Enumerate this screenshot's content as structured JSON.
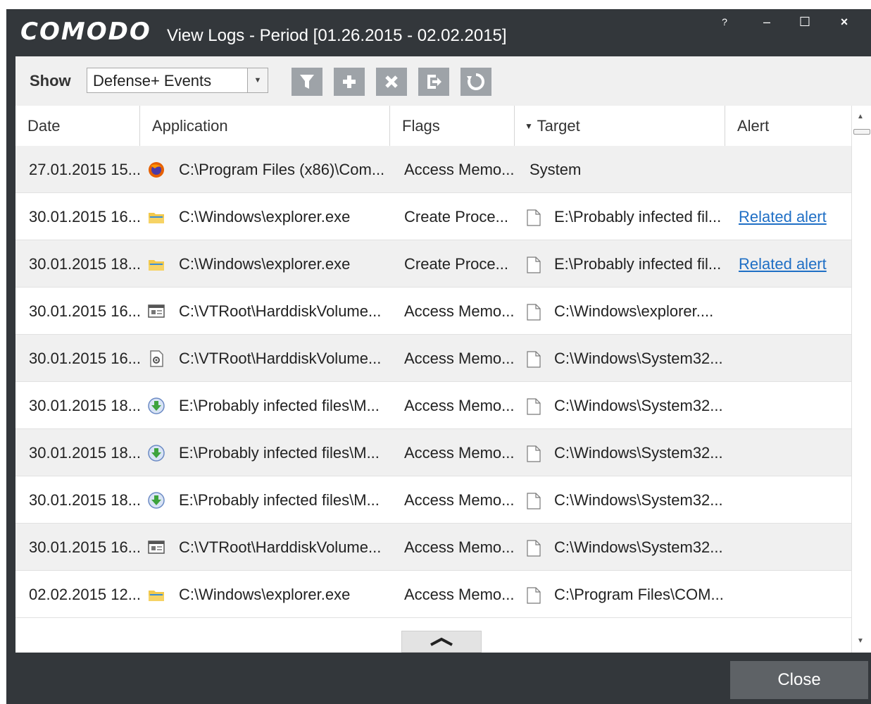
{
  "window": {
    "brand": "COMODO",
    "title": "View Logs - Period [01.26.2015 - 02.02.2015]",
    "help_label": "?",
    "minimize_label": "–",
    "maximize_label": "☐",
    "close_label": "×"
  },
  "toolbar": {
    "show_label": "Show",
    "filter_value": "Defense+ Events",
    "buttons": [
      "filter-icon",
      "add-icon",
      "delete-icon",
      "export-icon",
      "refresh-icon"
    ]
  },
  "table": {
    "columns": {
      "date": "Date",
      "application": "Application",
      "flags": "Flags",
      "target": "Target",
      "alert": "Alert"
    },
    "sorted_column": "Target",
    "rows": [
      {
        "date": "27.01.2015 15...",
        "app_icon": "firefox-icon",
        "application": "C:\\Program Files (x86)\\Com...",
        "flags": "Access Memo...",
        "target_icon": "",
        "target": "System",
        "alert": ""
      },
      {
        "date": "30.01.2015 16...",
        "app_icon": "folder-icon",
        "application": "C:\\Windows\\explorer.exe",
        "flags": "Create Proce...",
        "target_icon": "file-icon",
        "target": "E:\\Probably infected fil...",
        "alert": "Related alert"
      },
      {
        "date": "30.01.2015 18...",
        "app_icon": "folder-icon",
        "application": "C:\\Windows\\explorer.exe",
        "flags": "Create Proce...",
        "target_icon": "file-icon",
        "target": "E:\\Probably infected fil...",
        "alert": "Related alert"
      },
      {
        "date": "30.01.2015 16...",
        "app_icon": "window-app-icon",
        "application": "C:\\VTRoot\\HarddiskVolume...",
        "flags": "Access Memo...",
        "target_icon": "file-icon",
        "target": "C:\\Windows\\explorer....",
        "alert": ""
      },
      {
        "date": "30.01.2015 16...",
        "app_icon": "settings-file-icon",
        "application": "C:\\VTRoot\\HarddiskVolume...",
        "flags": "Access Memo...",
        "target_icon": "file-icon",
        "target": "C:\\Windows\\System32...",
        "alert": ""
      },
      {
        "date": "30.01.2015 18...",
        "app_icon": "download-icon",
        "application": "E:\\Probably infected files\\M...",
        "flags": "Access Memo...",
        "target_icon": "file-icon",
        "target": "C:\\Windows\\System32...",
        "alert": ""
      },
      {
        "date": "30.01.2015 18...",
        "app_icon": "download-icon",
        "application": "E:\\Probably infected files\\M...",
        "flags": "Access Memo...",
        "target_icon": "file-icon",
        "target": "C:\\Windows\\System32...",
        "alert": ""
      },
      {
        "date": "30.01.2015 18...",
        "app_icon": "download-icon",
        "application": "E:\\Probably infected files\\M...",
        "flags": "Access Memo...",
        "target_icon": "file-icon",
        "target": "C:\\Windows\\System32...",
        "alert": ""
      },
      {
        "date": "30.01.2015 16...",
        "app_icon": "window-app-icon",
        "application": "C:\\VTRoot\\HarddiskVolume...",
        "flags": "Access Memo...",
        "target_icon": "file-icon",
        "target": "C:\\Windows\\System32...",
        "alert": ""
      },
      {
        "date": "02.02.2015 12...",
        "app_icon": "folder-icon",
        "application": "C:\\Windows\\explorer.exe",
        "flags": "Access Memo...",
        "target_icon": "file-icon",
        "target": "C:\\Program Files\\COM...",
        "alert": ""
      }
    ]
  },
  "footer": {
    "close_label": "Close"
  },
  "colors": {
    "frame": "#33373b",
    "toolbar_bg": "#f0f0f0",
    "tool_button": "#9ea3a8",
    "link": "#1f6fc5",
    "close_button": "#5e6266"
  }
}
